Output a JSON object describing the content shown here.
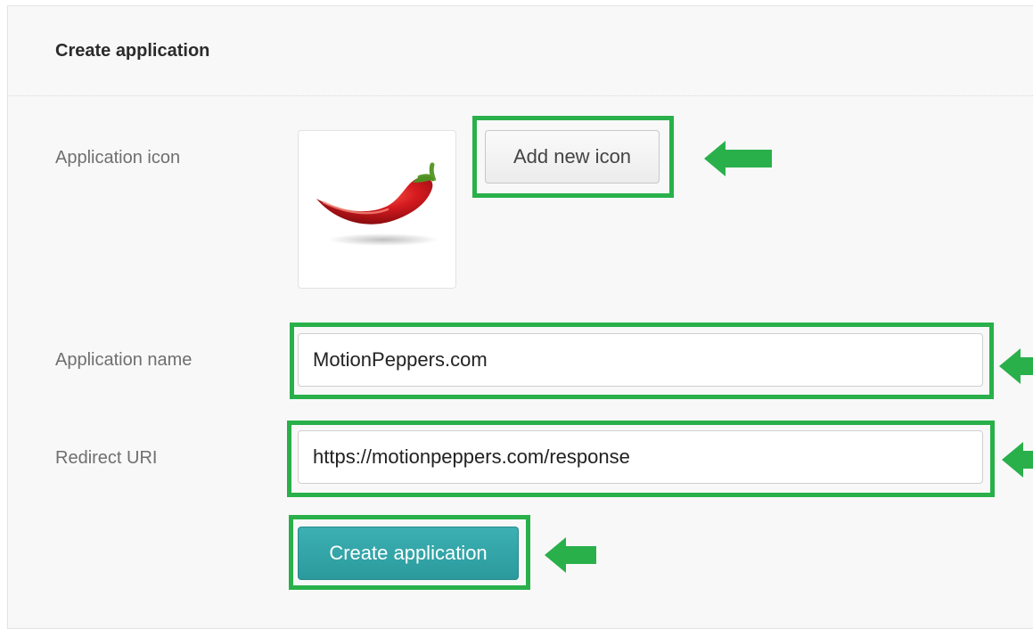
{
  "panel": {
    "title": "Create application"
  },
  "form": {
    "icon_label": "Application icon",
    "add_icon_button": "Add new icon",
    "name_label": "Application name",
    "name_value": "MotionPeppers.com",
    "redirect_label": "Redirect URI",
    "redirect_value": "https://motionpeppers.com/response",
    "submit_button": "Create application"
  },
  "icon": {
    "image_name": "chili-pepper-icon"
  },
  "colors": {
    "highlight": "#29b04a",
    "primary_button": "#2fa3a6",
    "pepper": "#c8161b",
    "stem": "#5b9a2a"
  },
  "annotations": {
    "arrow_icon_name": "green-arrow-left-icon"
  }
}
